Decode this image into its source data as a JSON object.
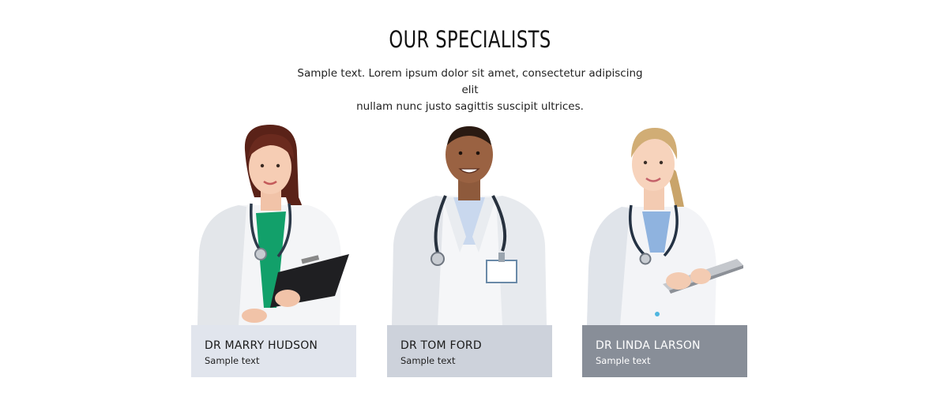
{
  "section": {
    "title": "OUR SPECIALISTS",
    "intro_line1": "Sample text. Lorem ipsum dolor sit amet, consectetur adipiscing elit",
    "intro_line2": "nullam nunc justo sagittis suscipit ultrices."
  },
  "specialists": [
    {
      "name": "DR MARRY HUDSON",
      "subtitle": "Sample text",
      "caption_color": "#e1e5ed",
      "photo": "female-doctor-with-clipboard"
    },
    {
      "name": "DR TOM FORD",
      "subtitle": "Sample text",
      "caption_color": "#cdd2db",
      "photo": "male-doctor-with-stethoscope"
    },
    {
      "name": "DR LINDA LARSON",
      "subtitle": "Sample text",
      "caption_color": "#888e98",
      "photo": "female-doctor-with-tablet"
    }
  ]
}
